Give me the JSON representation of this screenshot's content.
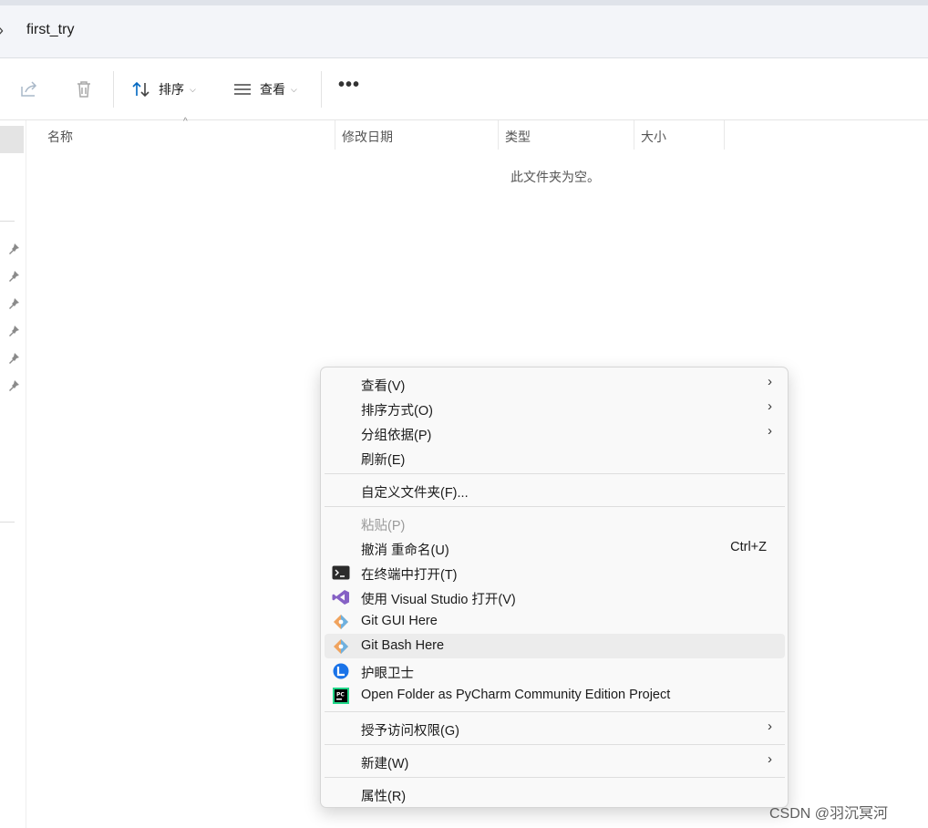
{
  "address": {
    "folder": "first_try",
    "chevron": "›"
  },
  "toolbar": {
    "share_icon": "share-icon",
    "delete_icon": "trash-icon",
    "sort_label": "排序",
    "view_label": "查看",
    "more_label": "•••"
  },
  "columns": [
    "名称",
    "修改日期",
    "类型",
    "大小"
  ],
  "empty_message": "此文件夹为空。",
  "context_menu": {
    "items": [
      {
        "label": "查看(V)",
        "submenu": true
      },
      {
        "label": "排序方式(O)",
        "submenu": true
      },
      {
        "label": "分组依据(P)",
        "submenu": true
      },
      {
        "label": "刷新(E)"
      },
      {
        "label": "自定义文件夹(F)..."
      },
      {
        "label": "粘贴(P)",
        "disabled": true
      },
      {
        "label": "撤消 重命名(U)",
        "shortcut": "Ctrl+Z"
      },
      {
        "label": "在终端中打开(T)",
        "icon": "terminal-icon"
      },
      {
        "label": "使用 Visual Studio 打开(V)",
        "icon": "visual-studio-icon"
      },
      {
        "label": "Git GUI Here",
        "icon": "git-icon"
      },
      {
        "label": "Git Bash Here",
        "icon": "git-icon"
      },
      {
        "label": "护眼卫士",
        "icon": "eye-guard-icon"
      },
      {
        "label": "Open Folder as PyCharm Community Edition Project",
        "icon": "pycharm-icon"
      },
      {
        "label": "授予访问权限(G)",
        "submenu": true
      },
      {
        "label": "新建(W)",
        "submenu": true
      },
      {
        "label": "属性(R)"
      }
    ],
    "arrow": "›"
  },
  "watermark": "CSDN @羽沉冥河",
  "colors": {
    "accent": "#0067c0",
    "vs_purple": "#8661c5",
    "git_orange": "#f05133",
    "menu_hover": "#ececec"
  }
}
